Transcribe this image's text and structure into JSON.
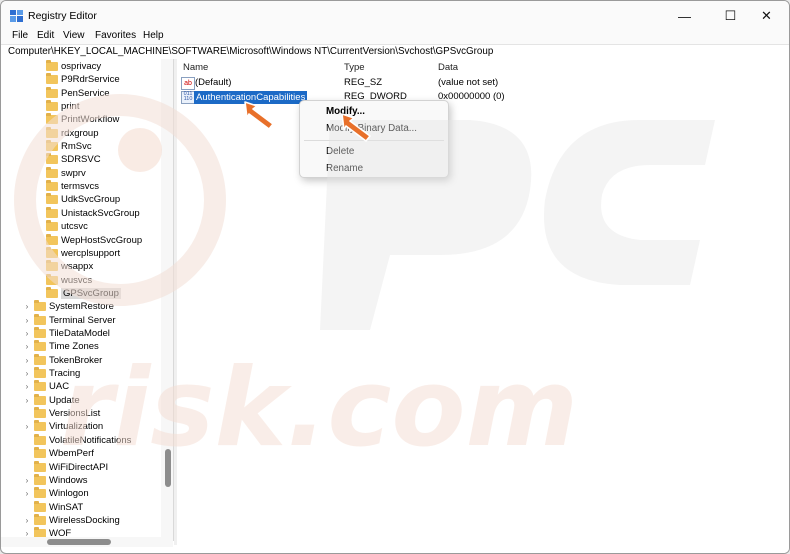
{
  "window": {
    "title": "Registry Editor",
    "controls": {
      "minimize": "—",
      "maximize": "☐",
      "close": "✕"
    }
  },
  "menubar": {
    "items": [
      "File",
      "Edit",
      "View",
      "Favorites",
      "Help"
    ]
  },
  "address": {
    "path": "Computer\\HKEY_LOCAL_MACHINE\\SOFTWARE\\Microsoft\\Windows NT\\CurrentVersion\\Svchost\\GPSvcGroup"
  },
  "tree": {
    "svchost_children": [
      "osprivacy",
      "P9RdrService",
      "PenService",
      "print",
      "PrintWorkflow",
      "rdxgroup",
      "RmSvc",
      "SDRSVC",
      "swprv",
      "termsvcs",
      "UdkSvcGroup",
      "UnistackSvcGroup",
      "utcsvc",
      "WepHostSvcGroup",
      "wercplsupport",
      "wsappx",
      "wusvcs",
      "GPSvcGroup"
    ],
    "selected": "GPSvcGroup",
    "siblings": [
      "SystemRestore",
      "Terminal Server",
      "TileDataModel",
      "Time Zones",
      "TokenBroker",
      "Tracing",
      "UAC",
      "Update",
      "VersionsList",
      "Virtualization",
      "VolatileNotifications",
      "WbemPerf",
      "WiFiDirectAPI",
      "Windows",
      "Winlogon",
      "WinSAT",
      "WirelessDocking",
      "WOF"
    ]
  },
  "list": {
    "columns": {
      "name": "Name",
      "type": "Type",
      "data": "Data"
    },
    "rows": [
      {
        "icon": "string-value-icon",
        "icon_text": "ab",
        "name": "(Default)",
        "type": "REG_SZ",
        "data": "(value not set)"
      },
      {
        "icon": "binary-value-icon",
        "icon_text": "011 110",
        "name": "AuthenticationCapabilities",
        "type": "REG_DWORD",
        "data": "0x00000000 (0)"
      }
    ]
  },
  "context_menu": {
    "items": [
      {
        "label": "Modify...",
        "bold": true
      },
      {
        "label": "Modify Binary Data..."
      },
      {
        "label": "Delete"
      },
      {
        "label": "Rename"
      }
    ]
  },
  "colors": {
    "selection": "#1c6ac6",
    "folder": "#f2c55c",
    "arrow": "#e8702a"
  }
}
